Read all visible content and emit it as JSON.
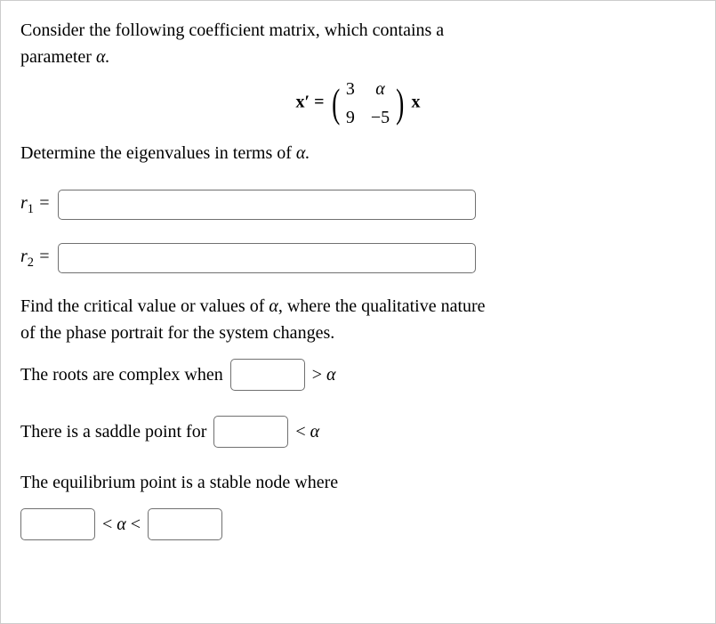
{
  "intro_line1": "Consider the following coefficient matrix, which contains a",
  "intro_line2": "parameter ",
  "intro_alpha_period": "α.",
  "eq_lhs": "x′ =",
  "matrix": {
    "a11": "3",
    "a12": "α",
    "a21": "9",
    "a22": "−5"
  },
  "eq_rhs": "x",
  "determine": "Determine the eigenvalues in terms of ",
  "determine_alpha": "α.",
  "r1_prefix": "r",
  "r1_sub": "1",
  "eqsym": " =",
  "r2_prefix": "r",
  "r2_sub": "2",
  "critical_line1": "Find the critical value or values of ",
  "critical_alpha": "α",
  "critical_line1b": ", where the qualitative nature",
  "critical_line2": "of the phase portrait for the system changes.",
  "roots_complex": "The roots are complex when",
  "gt_alpha": "> α",
  "saddle": "There is a saddle point for",
  "lt_alpha": "< α",
  "stable_node": "The equilibrium point is a stable node where",
  "lt_alpha_lt": "< α <"
}
